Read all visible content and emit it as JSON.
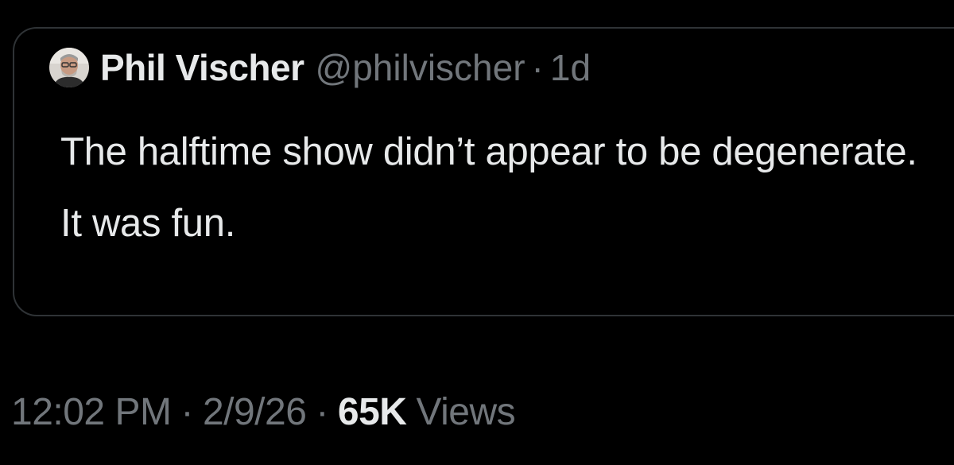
{
  "quoted_tweet": {
    "author": {
      "display_name": "Phil Vischer",
      "handle": "@philvischer",
      "avatar_icon": "user-avatar-photo"
    },
    "separator": "·",
    "time_ago": "1d",
    "text": "The halftime show didn’t appear to be degenerate. It was fun."
  },
  "meta": {
    "time": "12:02 PM",
    "separator": "·",
    "date": "2/9/26",
    "views_count": "65K",
    "views_label": "Views"
  },
  "colors": {
    "background": "#000000",
    "primary_text": "#e7e9ea",
    "secondary_text": "#71767b",
    "border": "#2f3336"
  }
}
